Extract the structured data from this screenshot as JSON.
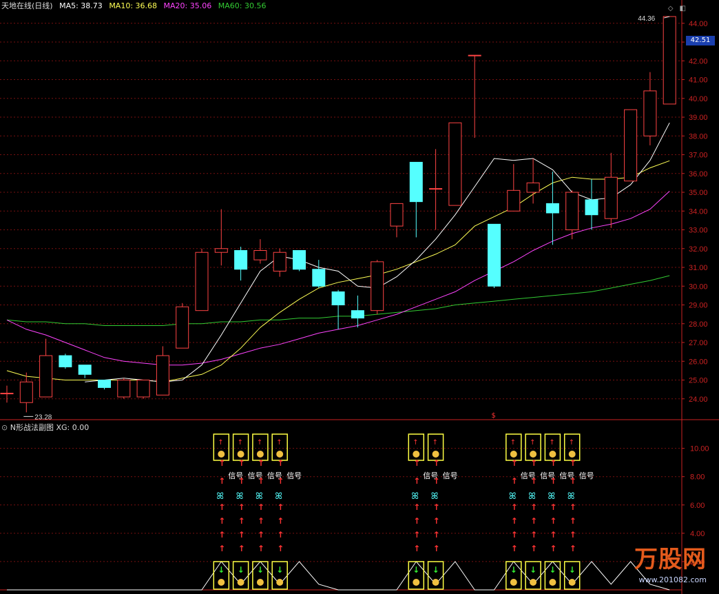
{
  "main_legend": {
    "title": "天地在线(日线)",
    "ma5": "MA5: 38.73",
    "ma10": "MA10: 36.68",
    "ma20": "MA20: 35.06",
    "ma60": "MA60: 30.56",
    "colors": {
      "title": "#dddddd",
      "ma5": "#ffffff",
      "ma10": "#ffff55",
      "ma20": "#ff44ff",
      "ma60": "#33cc33"
    }
  },
  "sub_legend": {
    "name": "N形战法副图",
    "xg": "XG: 0.00"
  },
  "price_marker": "42.51",
  "high_label": "44.36",
  "low_label": "23.28",
  "signal_text": "信号",
  "main_axis": {
    "min": 23.0,
    "max": 44.8,
    "ticks": [
      "44.00",
      "43.00",
      "42.00",
      "41.00",
      "40.00",
      "39.00",
      "38.00",
      "37.00",
      "36.00",
      "35.00",
      "34.00",
      "33.00",
      "32.00",
      "31.00",
      "30.00",
      "29.00",
      "28.00",
      "27.00",
      "26.00",
      "25.00",
      "24.00"
    ]
  },
  "sub_axis": {
    "min": 0.0,
    "max": 11.2,
    "ticks": [
      "10.00",
      "8.00",
      "6.00",
      "4.00",
      "2.00"
    ]
  },
  "brand": {
    "name": "万股网",
    "url": "www.201082.com"
  },
  "colors": {
    "up": "#ff4444",
    "down": "#55ffff",
    "grid": "#7a1010",
    "axis": "#cc2222",
    "tick_text": "#cc2222"
  },
  "chart_data": {
    "type": "candlestick",
    "candles": [
      {
        "o": 24.3,
        "h": 24.7,
        "l": 23.8,
        "c": 24.3
      },
      {
        "o": 23.8,
        "h": 25.4,
        "l": 23.28,
        "c": 24.9
      },
      {
        "o": 24.1,
        "h": 27.2,
        "l": 24.1,
        "c": 26.3
      },
      {
        "o": 26.3,
        "h": 26.4,
        "l": 25.6,
        "c": 25.7
      },
      {
        "o": 25.8,
        "h": 25.8,
        "l": 25.1,
        "c": 25.3
      },
      {
        "o": 25.0,
        "h": 25.0,
        "l": 24.5,
        "c": 24.6
      },
      {
        "o": 24.1,
        "h": 25.1,
        "l": 24.0,
        "c": 25.0
      },
      {
        "o": 24.1,
        "h": 24.9,
        "l": 24.0,
        "c": 25.0
      },
      {
        "o": 24.2,
        "h": 26.8,
        "l": 24.2,
        "c": 26.3
      },
      {
        "o": 26.7,
        "h": 29.1,
        "l": 26.7,
        "c": 28.9
      },
      {
        "o": 28.7,
        "h": 32.0,
        "l": 28.7,
        "c": 31.8
      },
      {
        "o": 31.8,
        "h": 34.1,
        "l": 31.1,
        "c": 32.0
      },
      {
        "o": 31.9,
        "h": 32.1,
        "l": 30.3,
        "c": 30.9
      },
      {
        "o": 31.4,
        "h": 32.5,
        "l": 31.2,
        "c": 31.9
      },
      {
        "o": 30.8,
        "h": 32.0,
        "l": 30.5,
        "c": 31.8
      },
      {
        "o": 31.9,
        "h": 31.9,
        "l": 30.8,
        "c": 30.9
      },
      {
        "o": 30.9,
        "h": 31.4,
        "l": 29.9,
        "c": 30.0
      },
      {
        "o": 29.7,
        "h": 29.8,
        "l": 27.7,
        "c": 29.0
      },
      {
        "o": 28.7,
        "h": 29.5,
        "l": 27.8,
        "c": 28.3
      },
      {
        "o": 28.7,
        "h": 31.4,
        "l": 28.5,
        "c": 31.3
      },
      {
        "o": 33.2,
        "h": 34.4,
        "l": 32.6,
        "c": 34.4
      },
      {
        "o": 36.6,
        "h": 36.6,
        "l": 32.6,
        "c": 34.5
      },
      {
        "o": 35.2,
        "h": 37.3,
        "l": 33.0,
        "c": 35.2
      },
      {
        "o": 34.3,
        "h": 38.7,
        "l": 34.3,
        "c": 38.7
      },
      {
        "o": 42.3,
        "h": 42.3,
        "l": 37.9,
        "c": 42.3
      },
      {
        "o": 33.3,
        "h": 33.3,
        "l": 29.9,
        "c": 30.0
      },
      {
        "o": 34.0,
        "h": 36.5,
        "l": 34.0,
        "c": 35.1
      },
      {
        "o": 35.0,
        "h": 36.8,
        "l": 34.4,
        "c": 35.5
      },
      {
        "o": 34.4,
        "h": 36.1,
        "l": 32.2,
        "c": 33.9
      },
      {
        "o": 33.0,
        "h": 35.1,
        "l": 32.5,
        "c": 35.0
      },
      {
        "o": 34.6,
        "h": 35.7,
        "l": 33.0,
        "c": 33.8
      },
      {
        "o": 33.6,
        "h": 37.1,
        "l": 33.1,
        "c": 35.8
      },
      {
        "o": 35.6,
        "h": 39.4,
        "l": 35.6,
        "c": 39.4
      },
      {
        "o": 38.0,
        "h": 41.4,
        "l": 37.5,
        "c": 40.4
      },
      {
        "o": 39.7,
        "h": 44.36,
        "l": 39.7,
        "c": 44.36
      }
    ],
    "ma5": [
      null,
      null,
      null,
      null,
      24.9,
      25.0,
      25.1,
      25.0,
      24.9,
      25.0,
      25.8,
      27.4,
      29.1,
      30.8,
      31.6,
      31.4,
      31.0,
      30.8,
      30.0,
      29.9,
      30.5,
      31.4,
      32.5,
      33.8,
      35.3,
      36.8,
      36.7,
      36.8,
      36.2,
      35.0,
      34.6,
      34.7,
      35.4,
      36.7,
      38.7
    ],
    "ma10": [
      25.5,
      25.2,
      25.1,
      25.0,
      25.0,
      25.0,
      25.0,
      25.0,
      24.9,
      25.1,
      25.3,
      25.8,
      26.7,
      27.8,
      28.6,
      29.3,
      29.9,
      30.2,
      30.4,
      30.6,
      30.9,
      31.3,
      31.7,
      32.2,
      33.2,
      33.7,
      34.2,
      34.9,
      35.5,
      35.8,
      35.7,
      35.7,
      35.8,
      36.3,
      36.68
    ],
    "ma20": [
      28.2,
      27.7,
      27.4,
      27.0,
      26.6,
      26.2,
      26.0,
      25.9,
      25.8,
      25.8,
      25.9,
      26.1,
      26.4,
      26.7,
      26.9,
      27.2,
      27.5,
      27.7,
      27.9,
      28.2,
      28.5,
      28.9,
      29.3,
      29.7,
      30.3,
      30.8,
      31.3,
      31.9,
      32.4,
      32.8,
      33.1,
      33.3,
      33.6,
      34.1,
      35.06
    ],
    "ma60": [
      28.2,
      28.1,
      28.1,
      28.0,
      28.0,
      27.9,
      27.9,
      27.9,
      27.9,
      28.0,
      28.0,
      28.1,
      28.1,
      28.2,
      28.2,
      28.3,
      28.3,
      28.4,
      28.4,
      28.5,
      28.6,
      28.7,
      28.8,
      29.0,
      29.1,
      29.2,
      29.3,
      29.4,
      29.5,
      29.6,
      29.7,
      29.9,
      30.1,
      30.3,
      30.56
    ],
    "signals": [
      11,
      12,
      13,
      14,
      21,
      22,
      26,
      27,
      28,
      29
    ],
    "sub_line": [
      0,
      0,
      0,
      0,
      0,
      0,
      0,
      0,
      0,
      0,
      0,
      2.0,
      0.4,
      2.0,
      0.4,
      2.0,
      0.4,
      0,
      0,
      0,
      0,
      2.0,
      0.4,
      2.0,
      0,
      0,
      2.0,
      0.4,
      2.0,
      0.4,
      2.0,
      0.4,
      2.0,
      0.4,
      0
    ]
  }
}
